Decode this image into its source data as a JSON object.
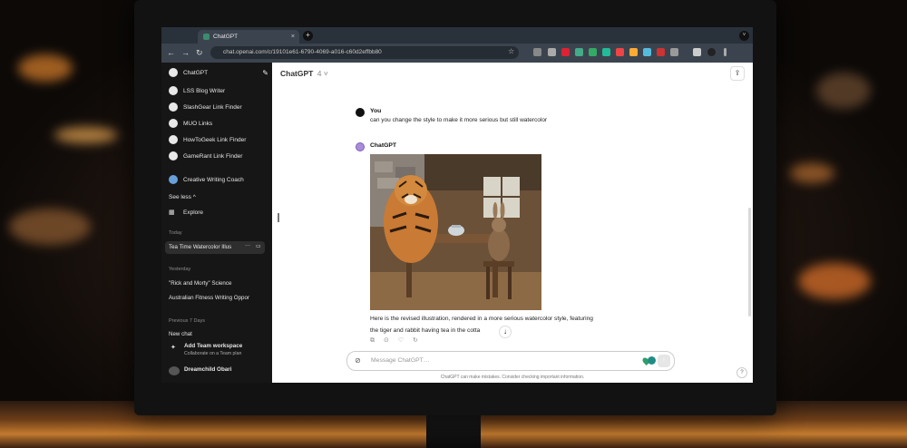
{
  "browser": {
    "tab_title": "ChatGPT",
    "tab_close": "×",
    "new_tab": "+",
    "url": "chat.openai.com/c/19101e61-6790-4069-a016-c60d2effbb80",
    "nav": {
      "back": "←",
      "forward": "→",
      "reload": "↻"
    },
    "star": "☆"
  },
  "sidebar": {
    "items": [
      {
        "label": "ChatGPT"
      },
      {
        "label": "LSS Blog Writer"
      },
      {
        "label": "SlashGear Link Finder"
      },
      {
        "label": "MUO Links"
      },
      {
        "label": "HowToGeek Link Finder"
      },
      {
        "label": "GameRant Link Finder"
      },
      {
        "label": "Creative Writing Coach"
      }
    ],
    "see_less": "See less ^",
    "explore": "Explore",
    "today_label": "Today",
    "today_chats": [
      "Tea Time Watercolor Illus"
    ],
    "yesterday_label": "Yesterday",
    "yesterday_chats": [
      "\"Rick and Morty\" Science",
      "Australian Fitness Writing Oppor"
    ],
    "prev7_label": "Previous 7 Days",
    "prev7_chats": [
      "New chat"
    ],
    "workspace_title": "Add Team workspace",
    "workspace_sub": "Collaborate on a Team plan",
    "user_name": "Dreamchild Obari",
    "active_more": "···"
  },
  "main": {
    "model_name": "ChatGPT",
    "model_version": "4 ˅",
    "share_icon": "⇪",
    "user_sender": "You",
    "user_message": "can you change the style to make it more serious but still watercolor",
    "assistant_sender": "ChatGPT",
    "reply_line1": "Here is the revised illustration, rendered in a more serious watercolor style, featuring",
    "reply_line2": "the tiger and rabbit having tea in the cotta",
    "actions": "⧉ ⊙ ♡ ↻",
    "scroll_down": "↓",
    "composer_placeholder": "Message ChatGPT…",
    "send": "↑",
    "disclaimer": "ChatGPT can make mistakes. Consider checking important information.",
    "help": "?"
  },
  "colors": {
    "sidebar_bg": "#161616",
    "chrome_bg": "#3b444e",
    "accent": "#ab8cdb"
  }
}
